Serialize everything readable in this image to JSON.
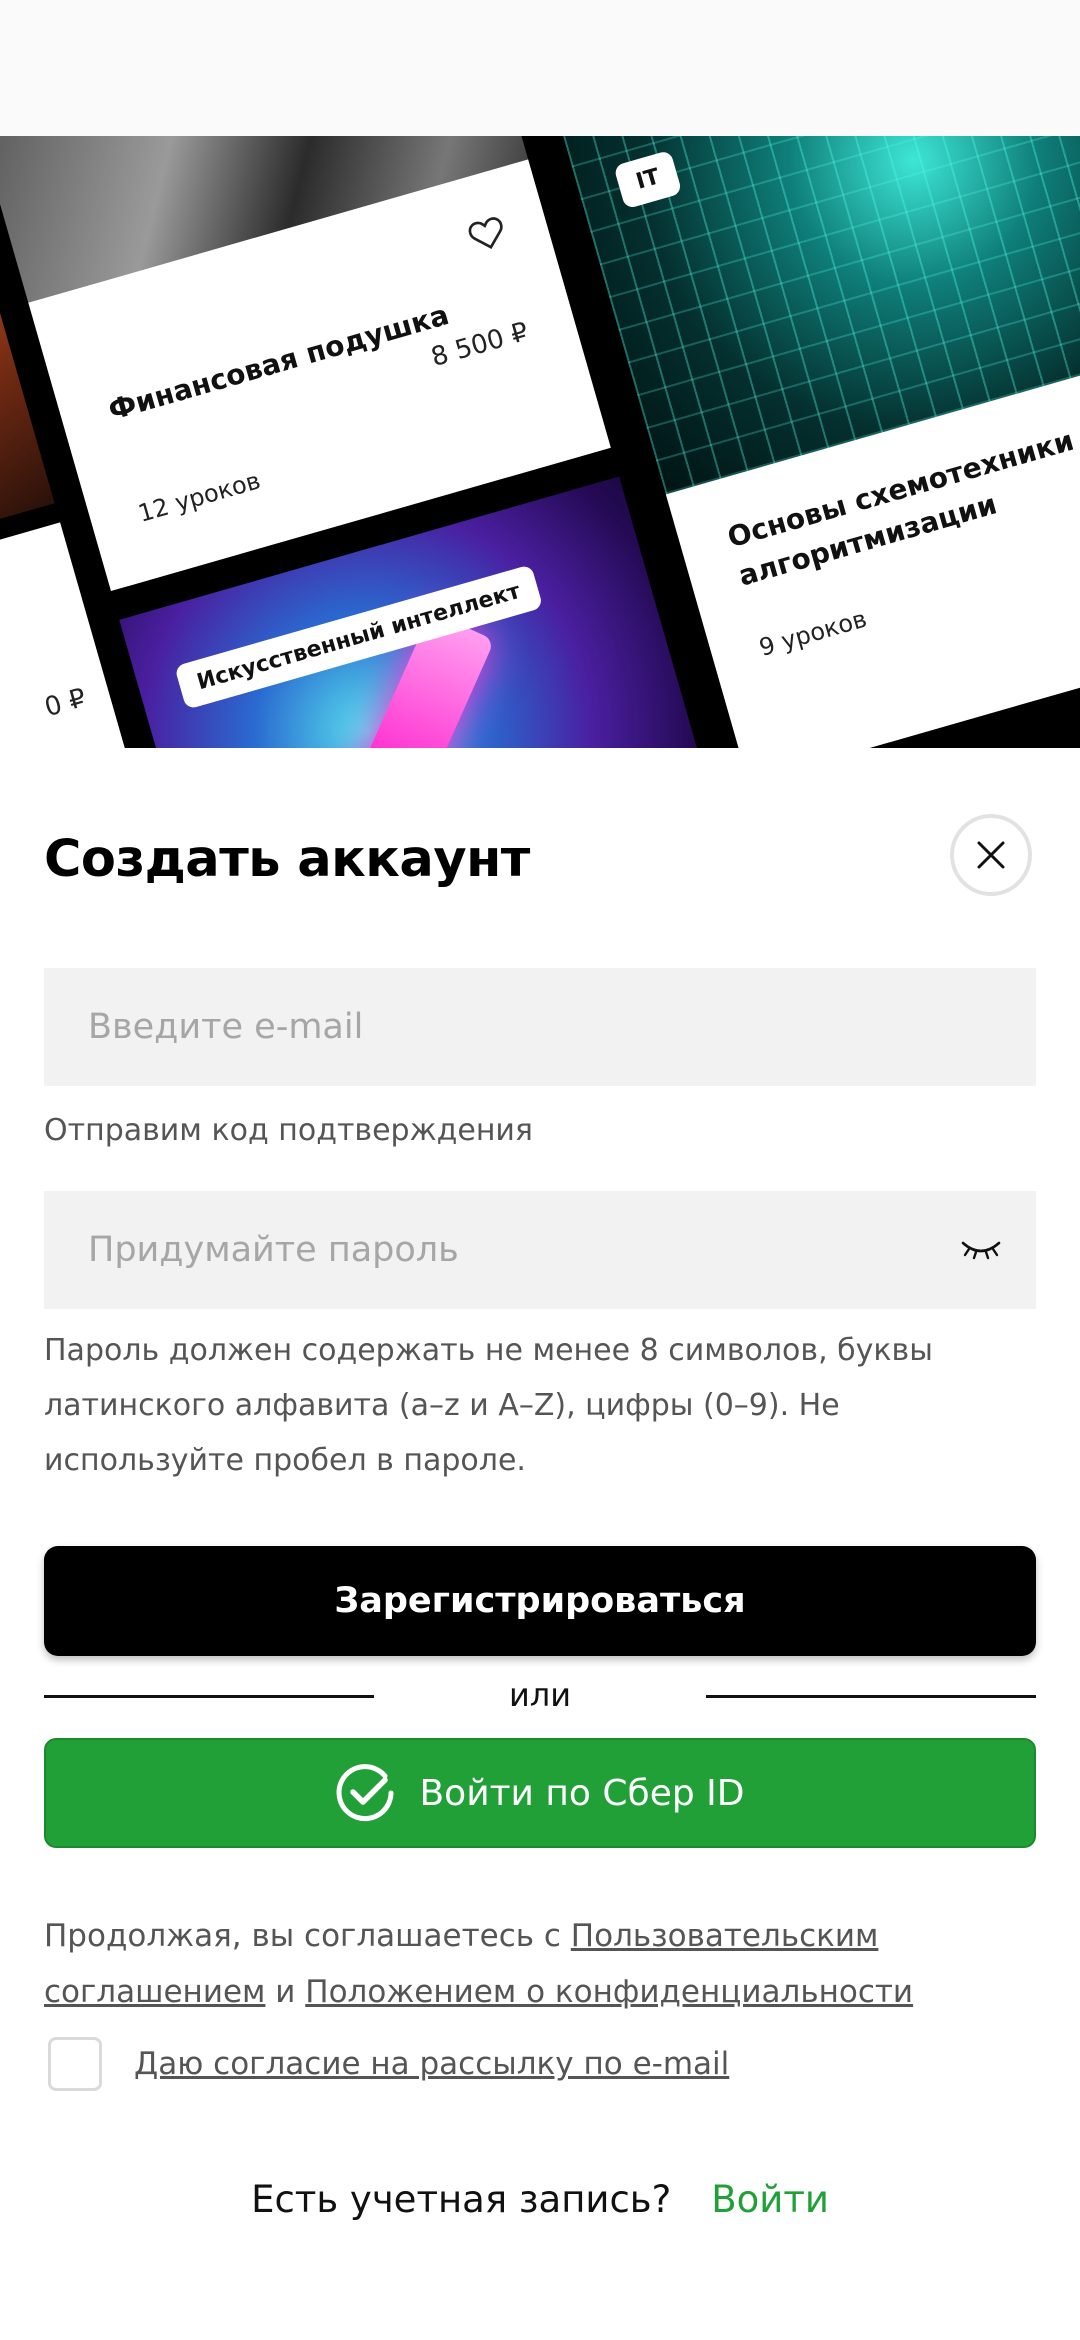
{
  "hero": {
    "finance_card": {
      "title": "Финансовая подушка",
      "price": "8 500 ₽",
      "lessons": "12 уроков"
    },
    "ai_card": {
      "tag": "Искусственный интеллект"
    },
    "left_card": {
      "price": "0 ₽"
    },
    "it_card": {
      "tag": "IT"
    },
    "scheme_card": {
      "title": "Основы схемотехники и алгоритмизации",
      "lessons": "9 уроков"
    }
  },
  "form": {
    "title": "Создать аккаунт",
    "email": {
      "placeholder": "Введите e-mail",
      "value": "",
      "hint": "Отправим код подтверждения"
    },
    "password": {
      "placeholder": "Придумайте пароль",
      "value": "",
      "hint": "Пароль должен содержать не менее 8 символов, буквы латинского алфавита (a–z и A–Z), цифры (0–9). Не используйте пробел в пароле."
    },
    "register_label": "Зарегистрироваться",
    "or_label": "или",
    "sber_label": "Войти по Сбер ID",
    "legal": {
      "prefix": "Продолжая, вы соглашаетесь с ",
      "terms_link": "Пользовательским соглашением",
      "joiner": " и ",
      "privacy_link": "Положением о конфиденциальности"
    },
    "consent_label": "Даю согласие на рассылку по e-mail",
    "consent_checked": false,
    "account_question": "Есть учетная запись?",
    "login_label": "Войти"
  },
  "colors": {
    "accent_green": "#21a038",
    "primary_black": "#000000",
    "field_bg": "#f2f2f2"
  },
  "icons": {
    "close": "close-icon",
    "eye": "eye-closed-icon",
    "sber": "sber-check-icon",
    "heart": "heart-icon"
  }
}
